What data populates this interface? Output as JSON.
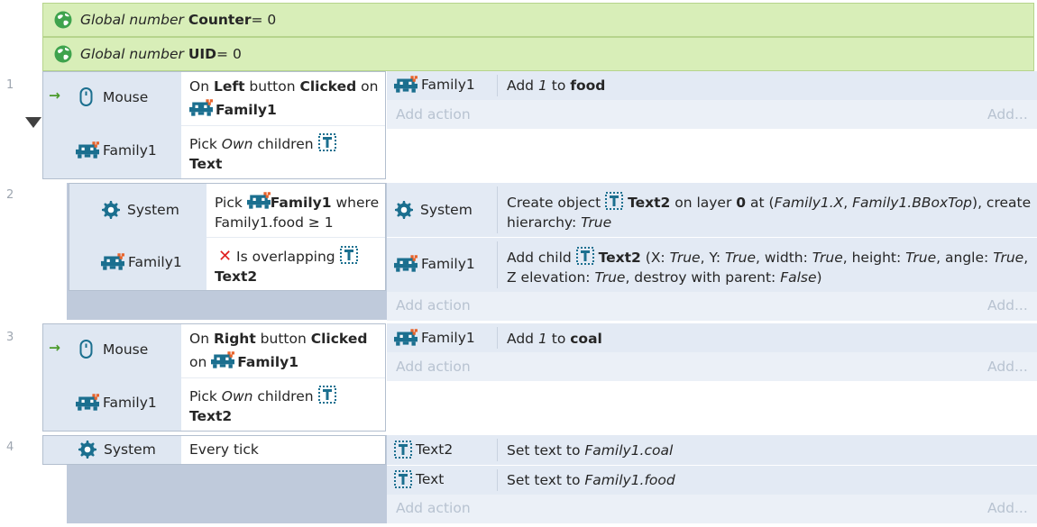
{
  "globals": [
    {
      "prefix": "Global number ",
      "name": "Counter",
      "suffix": " = 0"
    },
    {
      "prefix": "Global number ",
      "name": "UID",
      "suffix": " = 0"
    }
  ],
  "events": [
    {
      "num": "1"
    },
    {
      "num": "2"
    },
    {
      "num": "3"
    },
    {
      "num": "4"
    }
  ],
  "e1": {
    "c1_obj": "Mouse",
    "c1_t1": "On ",
    "c1_b1": "Left",
    "c1_t2": " button ",
    "c1_b2": "Clicked",
    "c1_t3": " on",
    "c1_obj2": "Family1",
    "c2_obj": "Family1",
    "c2_t1": "Pick ",
    "c2_i1": "Own",
    "c2_t2": " children",
    "c2_obj2": "Text",
    "a1_obj": "Family1",
    "a1_t1": "Add ",
    "a1_i1": "1",
    "a1_t2": " to ",
    "a1_b1": "food"
  },
  "e2": {
    "c1_obj": "System",
    "c1_t1": "Pick",
    "c1_obj2": "Family1",
    "c1_t2": "where",
    "c1_line2": "Family1.food ≥ 1",
    "c2_obj": "Family1",
    "c2_t1": "Is overlapping",
    "c2_obj2": "Text2",
    "a1_obj": "System",
    "a1_t1": "Create object ",
    "a1_b1": "Text2",
    "a1_t2": " on layer ",
    "a1_b2": "0",
    "a1_t3": " at (",
    "a1_i1": "Family1.X",
    "a1_t4": ", ",
    "a1_i2": "Family1.BBoxTop",
    "a1_t5": "), create",
    "a1_line2a": "hierarchy: ",
    "a1_line2i": "True",
    "a2_obj": "Family1",
    "a2_t1": "Add child ",
    "a2_b1": "Text2",
    "a2_t2": " (X: ",
    "a2_i1": "True",
    "a2_t3": ", Y: ",
    "a2_i2": "True",
    "a2_t4": ", width: ",
    "a2_i3": "True",
    "a2_t5": ", height: ",
    "a2_i4": "True",
    "a2_t6": ", angle: ",
    "a2_i5": "True",
    "a2_t7": ",",
    "a2_l2t1": "Z elevation: ",
    "a2_l2i1": "True",
    "a2_l2t2": ", destroy with parent: ",
    "a2_l2i2": "False",
    "a2_l2t3": ")"
  },
  "e3": {
    "c1_obj": "Mouse",
    "c1_t1": "On ",
    "c1_b1": "Right",
    "c1_t2": " button ",
    "c1_b2": "Clicked",
    "c1_t3": "on",
    "c1_obj2": "Family1",
    "c2_obj": "Family1",
    "c2_t1": "Pick ",
    "c2_i1": "Own",
    "c2_t2": " children",
    "c2_obj2": "Text2",
    "a1_obj": "Family1",
    "a1_t1": "Add ",
    "a1_i1": "1",
    "a1_t2": " to ",
    "a1_b1": "coal"
  },
  "e4": {
    "c1_obj": "System",
    "c1_t1": "Every tick",
    "a1_obj": "Text2",
    "a1_t1": "Set text to ",
    "a1_i1": "Family1.coal",
    "a2_obj": "Text",
    "a2_t1": "Set text to ",
    "a2_i1": "Family1.food"
  },
  "add_action": "Add action",
  "add_right": "Add...",
  "icons": {
    "globe": "globe-icon",
    "mouse": "mouse-icon",
    "family": "family-sprite-icon",
    "text": "text-object-icon",
    "system": "gear-icon",
    "trigger": "trigger-arrow-icon",
    "inverted": "red-x-icon",
    "collapse": "collapse-triangle-icon"
  },
  "colors": {
    "global_bg": "#d8eeb8",
    "action_bg": "#e3eaf4",
    "object_col": "#dfe7f2",
    "family_icon": "#1b6f8f",
    "trigger_green": "#4a9a2a",
    "invert_red": "#e02020"
  }
}
